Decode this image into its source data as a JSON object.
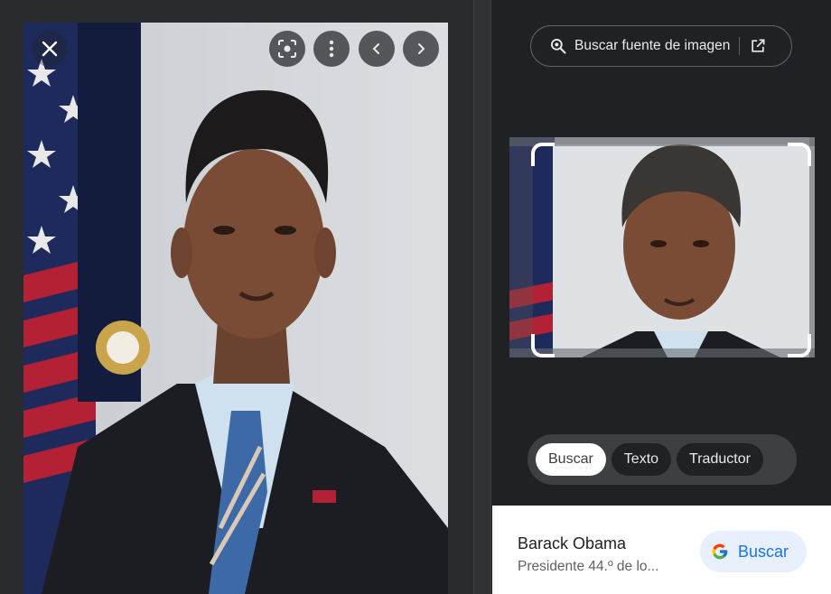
{
  "viewer": {
    "toolbar_icons": [
      "close-icon",
      "lens-icon",
      "more-vert-icon",
      "chevron-left-icon",
      "chevron-right-icon"
    ]
  },
  "lens": {
    "source_button_label": "Buscar fuente de imagen",
    "modes": [
      {
        "label": "Buscar",
        "active": true
      },
      {
        "label": "Texto",
        "active": false
      },
      {
        "label": "Traductor",
        "active": false
      }
    ]
  },
  "result": {
    "title": "Barack Obama",
    "subtitle": "Presidente 44.º de lo...",
    "search_button_label": "Buscar"
  },
  "colors": {
    "background": "#202124",
    "accent": "#1a73e8",
    "chip_active": "#ffffff"
  }
}
